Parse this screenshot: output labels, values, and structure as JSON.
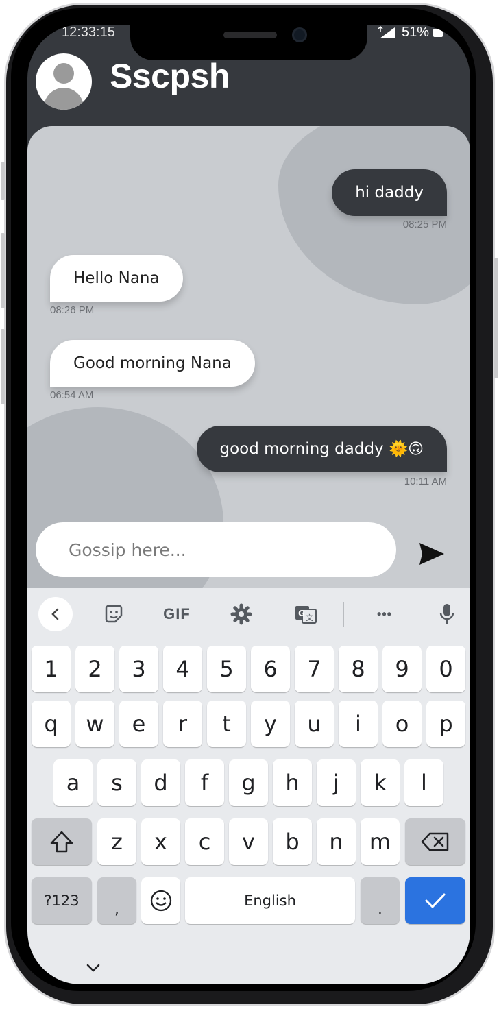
{
  "status_bar": {
    "time": "12:33:15",
    "battery": "51%"
  },
  "header": {
    "contact_name": "Sscpsh",
    "avatar_icon": "user-avatar-icon"
  },
  "messages": [
    {
      "direction": "outgoing",
      "text": "hi daddy",
      "time": "08:25 PM"
    },
    {
      "direction": "incoming",
      "text": "Hello Nana",
      "time": "08:26 PM"
    },
    {
      "direction": "incoming",
      "text": "Good morning Nana",
      "time": "06:54 AM"
    },
    {
      "direction": "outgoing",
      "text": "good morning daddy",
      "emoji": "🌞🙃",
      "time": "10:11 AM"
    }
  ],
  "composer": {
    "placeholder": "Gossip here...",
    "send_icon": "send-icon"
  },
  "keyboard": {
    "toolbar": [
      "back-icon",
      "sticker-icon",
      "GIF",
      "settings-icon",
      "translate-icon",
      "more-icon",
      "mic-icon"
    ],
    "gif_label": "GIF",
    "more_label": "•••",
    "row_numbers": [
      "1",
      "2",
      "3",
      "4",
      "5",
      "6",
      "7",
      "8",
      "9",
      "0"
    ],
    "row_top": [
      "q",
      "w",
      "e",
      "r",
      "t",
      "y",
      "u",
      "i",
      "o",
      "p"
    ],
    "row_middle": [
      "a",
      "s",
      "d",
      "f",
      "g",
      "h",
      "j",
      "k",
      "l"
    ],
    "row_bottom": [
      "z",
      "x",
      "c",
      "v",
      "b",
      "n",
      "m"
    ],
    "symbols_label": "?123",
    "comma_label": ",",
    "space_label": "English",
    "period_label": "."
  },
  "colors": {
    "header_bg": "#36393e",
    "chat_bg": "#c9ccd0",
    "outgoing_bubble": "#36393e",
    "incoming_bubble": "#ffffff",
    "enter_key": "#2b73e0"
  }
}
